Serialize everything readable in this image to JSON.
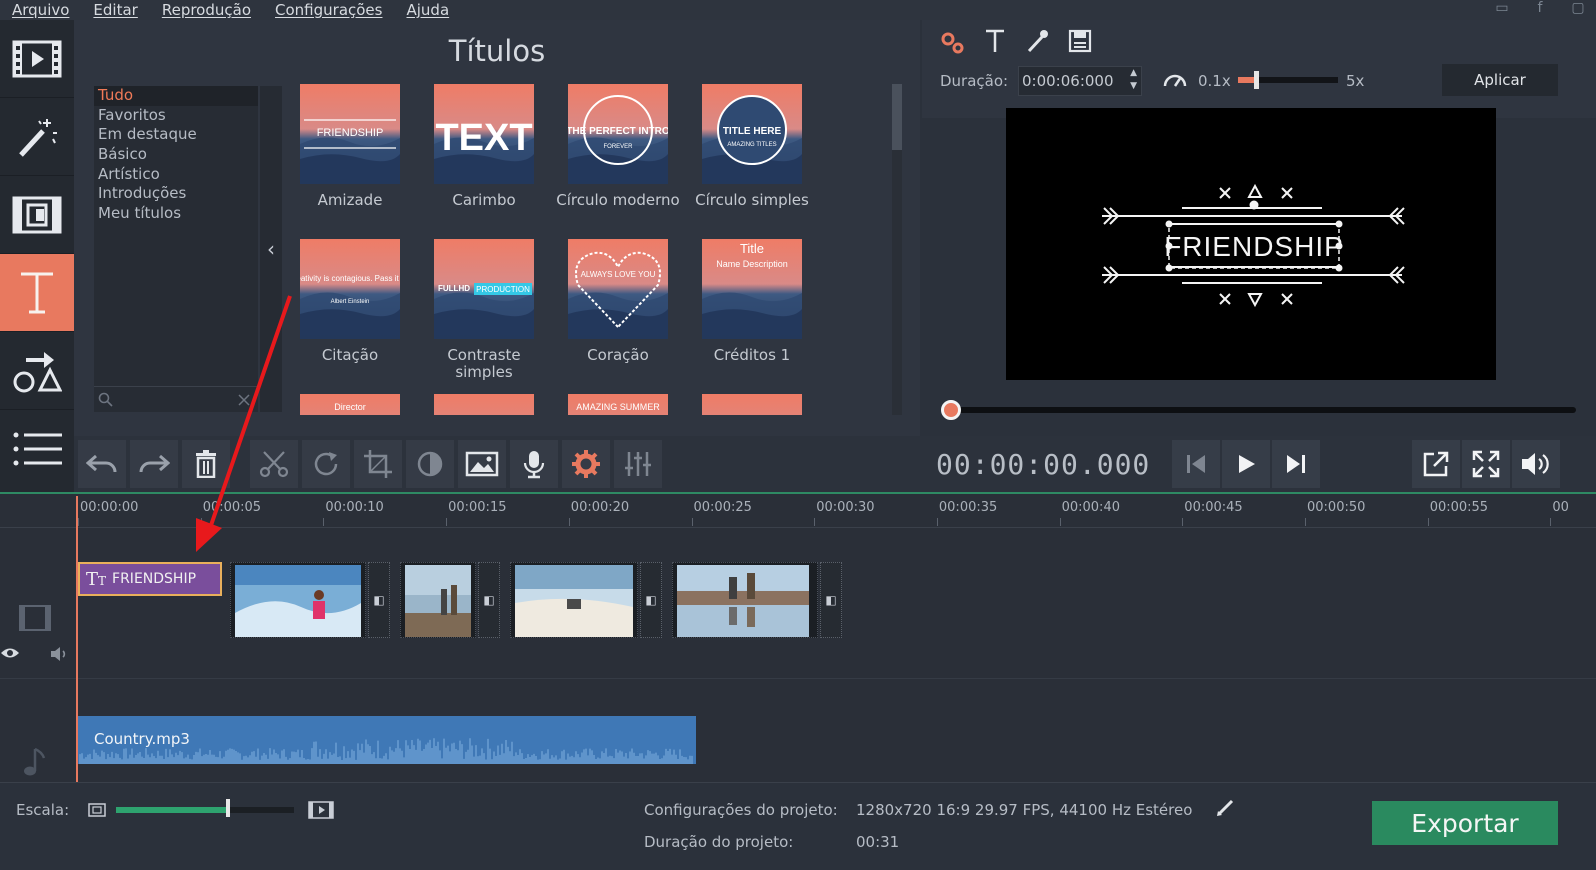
{
  "menu": [
    "Arquivo",
    "Editar",
    "Reprodução",
    "Configurações",
    "Ajuda"
  ],
  "colors": {
    "accent": "#e8795f",
    "export": "#2a8a5f",
    "title_clip": "#7a4e9c",
    "audio_clip": "#3f78b6"
  },
  "left_toolbar": {
    "items": [
      {
        "name": "import-media",
        "icon": "film-icon"
      },
      {
        "name": "filters",
        "icon": "magic-wand-icon"
      },
      {
        "name": "transitions",
        "icon": "transition-icon"
      },
      {
        "name": "titles",
        "icon": "text-icon",
        "active": true
      },
      {
        "name": "stickers",
        "icon": "shapes-icon"
      },
      {
        "name": "more",
        "icon": "list-icon"
      }
    ]
  },
  "titles": {
    "heading": "Títulos",
    "categories": [
      "Tudo",
      "Favoritos",
      "Em destaque",
      "Básico",
      "Artístico",
      "Introduções",
      "Meu títulos"
    ],
    "items": [
      {
        "label": "Amizade",
        "thumb_text": "FRIENDSHIP"
      },
      {
        "label": "Carimbo",
        "thumb_text": "TEXT"
      },
      {
        "label": "Círculo moderno",
        "thumb_text": "THE PERFECT INTRO",
        "thumb_sub": "FOREVER"
      },
      {
        "label": "Círculo simples",
        "thumb_text": "TITLE HERE",
        "thumb_sub": "AMAZING TITLES"
      },
      {
        "label": "Citação",
        "thumb_text": "Creativity is contagious. Pass it on.",
        "thumb_sub": "Albert Einstein"
      },
      {
        "label": "Contraste simples",
        "thumb_text": "FULLHD",
        "thumb_sub": "PRODUCTION"
      },
      {
        "label": "Coração",
        "thumb_text": "ALWAYS LOVE YOU"
      },
      {
        "label": "Créditos 1",
        "thumb_text": "Title",
        "thumb_sub": "Name Description"
      },
      {
        "label": "",
        "thumb_text": "Director"
      },
      {
        "label": "",
        "thumb_text": ""
      },
      {
        "label": "",
        "thumb_text": "AMAZING SUMMER"
      },
      {
        "label": "",
        "thumb_text": ""
      }
    ]
  },
  "preview": {
    "duration_label": "Duração:",
    "duration_value": "0:00:06:000",
    "speed_min": "0.1x",
    "speed_max": "5x",
    "apply_label": "Aplicar",
    "preview_text": "FRIENDSHIP"
  },
  "transport": {
    "timecode": "00:00:00.000"
  },
  "timeline": {
    "ticks": [
      "00:00:00",
      "00:00:05",
      "00:00:10",
      "00:00:15",
      "00:00:20",
      "00:00:25",
      "00:00:30",
      "00:00:35",
      "00:00:40",
      "00:00:45",
      "00:00:50",
      "00:00:55",
      "00"
    ],
    "title_clip": "FRIENDSHIP",
    "audio_clip": "Country.mp3"
  },
  "status": {
    "scale_label": "Escala:",
    "scale_level": 0.63,
    "settings_label": "Configurações do projeto:",
    "settings_value": "1280x720 16:9 29.97 FPS, 44100 Hz Estéreo",
    "duration_label": "Duração do projeto:",
    "duration_value": "00:31",
    "export_label": "Exportar"
  }
}
